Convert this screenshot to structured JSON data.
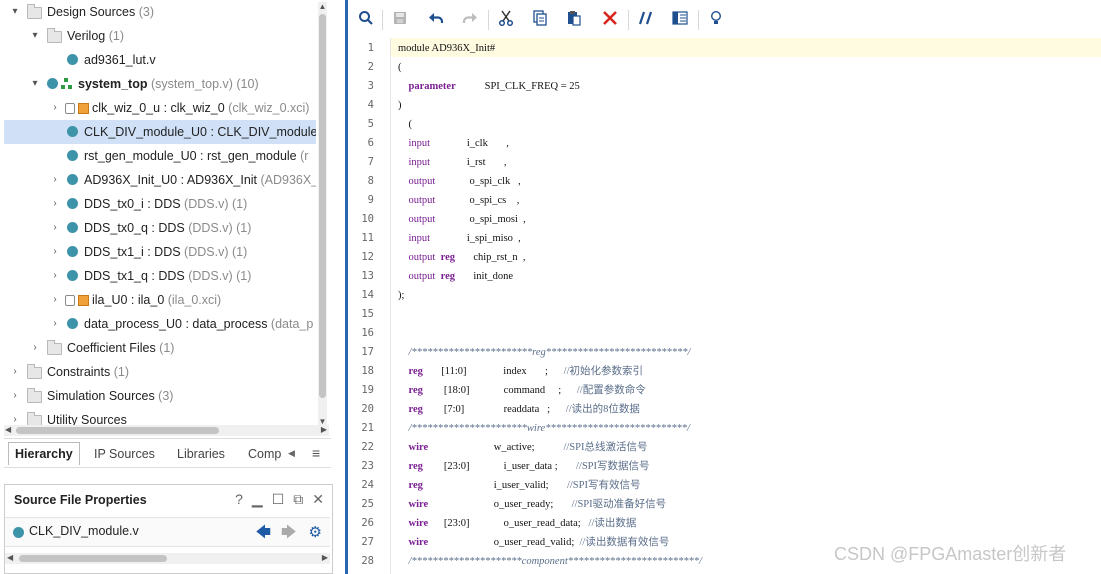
{
  "tree": [
    {
      "label": "Design Sources",
      "sub": " (3)",
      "indent": 0,
      "arrow": "▾",
      "icon": "folder",
      "bold": false
    },
    {
      "label": "Verilog",
      "sub": " (1)",
      "indent": 1,
      "arrow": "▾",
      "icon": "folder",
      "bold": false
    },
    {
      "label": "ad9361_lut.v",
      "sub": "",
      "indent": 2,
      "arrow": "",
      "icon": "dot",
      "bold": false
    },
    {
      "label": "system_top",
      "sub": " (system_top.v) (10)",
      "indent": 1,
      "arrow": "▾",
      "icon": "top",
      "bold": true
    },
    {
      "label": "clk_wiz_0_u : clk_wiz_0",
      "sub": " (clk_wiz_0.xci)",
      "indent": 2,
      "arrow": "›",
      "icon": "ip",
      "bold": false
    },
    {
      "label": "CLK_DIV_module_U0 : CLK_DIV_module",
      "sub": "",
      "indent": 2,
      "arrow": "",
      "icon": "dot",
      "bold": false,
      "selected": true
    },
    {
      "label": "rst_gen_module_U0 : rst_gen_module",
      "sub": " (r",
      "indent": 2,
      "arrow": "",
      "icon": "dot",
      "bold": false
    },
    {
      "label": "AD936X_Init_U0 : AD936X_Init",
      "sub": " (AD936X_",
      "indent": 2,
      "arrow": "›",
      "icon": "dot",
      "bold": false
    },
    {
      "label": "DDS_tx0_i : DDS",
      "sub": " (DDS.v) (1)",
      "indent": 2,
      "arrow": "›",
      "icon": "dot",
      "bold": false
    },
    {
      "label": "DDS_tx0_q : DDS",
      "sub": " (DDS.v) (1)",
      "indent": 2,
      "arrow": "›",
      "icon": "dot",
      "bold": false
    },
    {
      "label": "DDS_tx1_i : DDS",
      "sub": " (DDS.v) (1)",
      "indent": 2,
      "arrow": "›",
      "icon": "dot",
      "bold": false
    },
    {
      "label": "DDS_tx1_q : DDS",
      "sub": " (DDS.v) (1)",
      "indent": 2,
      "arrow": "›",
      "icon": "dot",
      "bold": false
    },
    {
      "label": "ila_U0 : ila_0",
      "sub": " (ila_0.xci)",
      "indent": 2,
      "arrow": "›",
      "icon": "ip",
      "bold": false
    },
    {
      "label": "data_process_U0 : data_process",
      "sub": " (data_p",
      "indent": 2,
      "arrow": "›",
      "icon": "dot",
      "bold": false
    },
    {
      "label": "Coefficient Files",
      "sub": " (1)",
      "indent": 1,
      "arrow": "›",
      "icon": "folder",
      "bold": false
    },
    {
      "label": "Constraints",
      "sub": " (1)",
      "indent": 0,
      "arrow": "›",
      "icon": "folder",
      "bold": false
    },
    {
      "label": "Simulation Sources",
      "sub": " (3)",
      "indent": 0,
      "arrow": "›",
      "icon": "folder",
      "bold": false
    },
    {
      "label": "Utility Sources",
      "sub": "",
      "indent": 0,
      "arrow": "›",
      "icon": "folder",
      "bold": false
    }
  ],
  "tabs": [
    "Hierarchy",
    "IP Sources",
    "Libraries",
    "Comp"
  ],
  "active_tab": "Hierarchy",
  "source_file_properties": {
    "title": "Source File Properties",
    "help": "?",
    "file": "CLK_DIV_module.v"
  },
  "toolbar": [
    "search",
    "save",
    "undo",
    "redo",
    "cut",
    "copy",
    "paste",
    "delete",
    "comment",
    "columns",
    "bulb"
  ],
  "code_lines": [
    [
      {
        "t": "module AD936X_Init#",
        "c": ""
      }
    ],
    [
      {
        "t": "(",
        "c": ""
      }
    ],
    [
      {
        "t": "    ",
        "c": ""
      },
      {
        "t": "parameter",
        "c": "kwb"
      },
      {
        "t": "           SPI_CLK_FREQ = 25",
        "c": ""
      }
    ],
    [
      {
        "t": ")",
        "c": ""
      }
    ],
    [
      {
        "t": "    (",
        "c": ""
      }
    ],
    [
      {
        "t": "    ",
        "c": ""
      },
      {
        "t": "input",
        "c": "kw"
      },
      {
        "t": "              i_clk       ,",
        "c": ""
      }
    ],
    [
      {
        "t": "    ",
        "c": ""
      },
      {
        "t": "input",
        "c": "kw"
      },
      {
        "t": "              i_rst       ,",
        "c": ""
      }
    ],
    [
      {
        "t": "    ",
        "c": ""
      },
      {
        "t": "output",
        "c": "kw"
      },
      {
        "t": "             o_spi_clk   ,",
        "c": ""
      }
    ],
    [
      {
        "t": "    ",
        "c": ""
      },
      {
        "t": "output",
        "c": "kw"
      },
      {
        "t": "             o_spi_cs    ,",
        "c": ""
      }
    ],
    [
      {
        "t": "    ",
        "c": ""
      },
      {
        "t": "output",
        "c": "kw"
      },
      {
        "t": "             o_spi_mosi  ,",
        "c": ""
      }
    ],
    [
      {
        "t": "    ",
        "c": ""
      },
      {
        "t": "input",
        "c": "kw"
      },
      {
        "t": "              i_spi_miso  ,",
        "c": ""
      }
    ],
    [
      {
        "t": "    ",
        "c": ""
      },
      {
        "t": "output",
        "c": "kw"
      },
      {
        "t": "  ",
        "c": ""
      },
      {
        "t": "reg",
        "c": "kwb"
      },
      {
        "t": "       chip_rst_n  ,",
        "c": ""
      }
    ],
    [
      {
        "t": "    ",
        "c": ""
      },
      {
        "t": "output",
        "c": "kw"
      },
      {
        "t": "  ",
        "c": ""
      },
      {
        "t": "reg",
        "c": "kwb"
      },
      {
        "t": "       init_done",
        "c": ""
      }
    ],
    [
      {
        "t": ");",
        "c": ""
      }
    ],
    [],
    [],
    [
      {
        "t": "    /***********************reg***************************/",
        "c": "cmt"
      }
    ],
    [
      {
        "t": "    ",
        "c": ""
      },
      {
        "t": "reg",
        "c": "kwb"
      },
      {
        "t": "       [11:0]              index       ;      ",
        "c": ""
      },
      {
        "t": "//初始化参数索引",
        "c": "cmtcn"
      }
    ],
    [
      {
        "t": "    ",
        "c": ""
      },
      {
        "t": "reg",
        "c": "kwb"
      },
      {
        "t": "        [18:0]             command     ;      ",
        "c": ""
      },
      {
        "t": "//配置参数命令",
        "c": "cmtcn"
      }
    ],
    [
      {
        "t": "    ",
        "c": ""
      },
      {
        "t": "reg",
        "c": "kwb"
      },
      {
        "t": "        [7:0]               readdata   ;      ",
        "c": ""
      },
      {
        "t": "//读出的8位数据",
        "c": "cmtcn"
      }
    ],
    [
      {
        "t": "    /**********************wire***************************/",
        "c": "cmt"
      }
    ],
    [
      {
        "t": "    ",
        "c": ""
      },
      {
        "t": "wire",
        "c": "kwb"
      },
      {
        "t": "                         w_active;           ",
        "c": ""
      },
      {
        "t": "//SPI总线激活信号",
        "c": "cmtcn"
      }
    ],
    [
      {
        "t": "    ",
        "c": ""
      },
      {
        "t": "reg",
        "c": "kwb"
      },
      {
        "t": "        [23:0]             i_user_data ;       ",
        "c": ""
      },
      {
        "t": "//SPI写数据信号",
        "c": "cmtcn"
      }
    ],
    [
      {
        "t": "    ",
        "c": ""
      },
      {
        "t": "reg",
        "c": "kwb"
      },
      {
        "t": "                           i_user_valid;       ",
        "c": ""
      },
      {
        "t": "//SPI写有效信号",
        "c": "cmtcn"
      }
    ],
    [
      {
        "t": "    ",
        "c": ""
      },
      {
        "t": "wire",
        "c": "kwb"
      },
      {
        "t": "                         o_user_ready;       ",
        "c": ""
      },
      {
        "t": "//SPI驱动准备好信号",
        "c": "cmtcn"
      }
    ],
    [
      {
        "t": "    ",
        "c": ""
      },
      {
        "t": "wire",
        "c": "kwb"
      },
      {
        "t": "      [23:0]             o_user_read_data;   ",
        "c": ""
      },
      {
        "t": "//读出数据",
        "c": "cmtcn"
      }
    ],
    [
      {
        "t": "    ",
        "c": ""
      },
      {
        "t": "wire",
        "c": "kwb"
      },
      {
        "t": "                         o_user_read_valid;  ",
        "c": ""
      },
      {
        "t": "//读出数据有效信号",
        "c": "cmtcn"
      }
    ],
    [
      {
        "t": "    /*********************component*************************/",
        "c": "cmt"
      }
    ]
  ],
  "watermark": "CSDN @FPGAmaster创新者"
}
